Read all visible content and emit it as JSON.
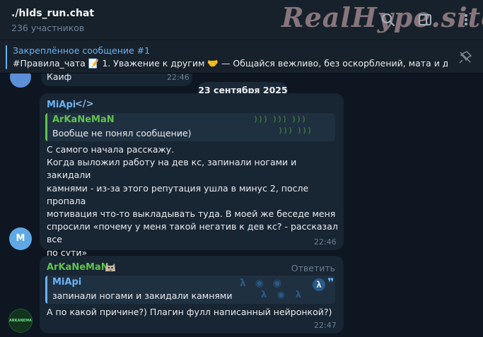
{
  "header": {
    "title": "./hlds_run.chat",
    "subtitle": "236 участников",
    "watermark": "RealHype.site",
    "icons": [
      "search-icon",
      "columns-icon",
      "more-icon"
    ]
  },
  "pinned": {
    "title": "Закреплённое сообщение #1",
    "text": "#Правила_чата 📝  1. Уважение к другим 🤝   — Общайся вежливо, без оскорблений, мата и д..."
  },
  "previous_message": {
    "text": "Каиф",
    "time": "22:46"
  },
  "date_separator": "23 сентября 2025",
  "messages": [
    {
      "avatar_letter": "M",
      "sender": "MiApi",
      "sender_tag": "</>",
      "sender_color": "#6ab3f3",
      "reply": {
        "name": "ArKaNeMaN",
        "text": "Вообще не понял сообщение)",
        "color": "#5fc44c"
      },
      "text": "С самого начала расскажу.\nКогда выложил работу на дев кс, запинали ногами и закидали\nкамнями - из-за этого репутация ушла в минус 2, после пропала\nмотивация что-то выкладывать туда. В моей же беседе меня\nспросили «почему у меня такой негатив к дев кс? - рассказал все\nпо сути»\nЧерез месяц кто-то пожаловался Алексеичу, за что я получил\nбан и на сайте и в беседе дев кс",
      "time": "22:46"
    },
    {
      "avatar_label": "ARKANEMAN",
      "sender": "ArKaNeMaN",
      "sender_color": "#5fc44c",
      "reply_action": "Ответить",
      "reply": {
        "name": "MiApi",
        "text": "запинали ногами и закидали камнями",
        "color": "#6ab3f3"
      },
      "text": "А по какой причине?) Плагин фулл написанный нейронкой?)",
      "time": "22:47"
    }
  ],
  "colors": {
    "background": "#0e1621",
    "bubble": "#182533",
    "accent": "#6ab3f3",
    "green": "#5fc44c"
  }
}
